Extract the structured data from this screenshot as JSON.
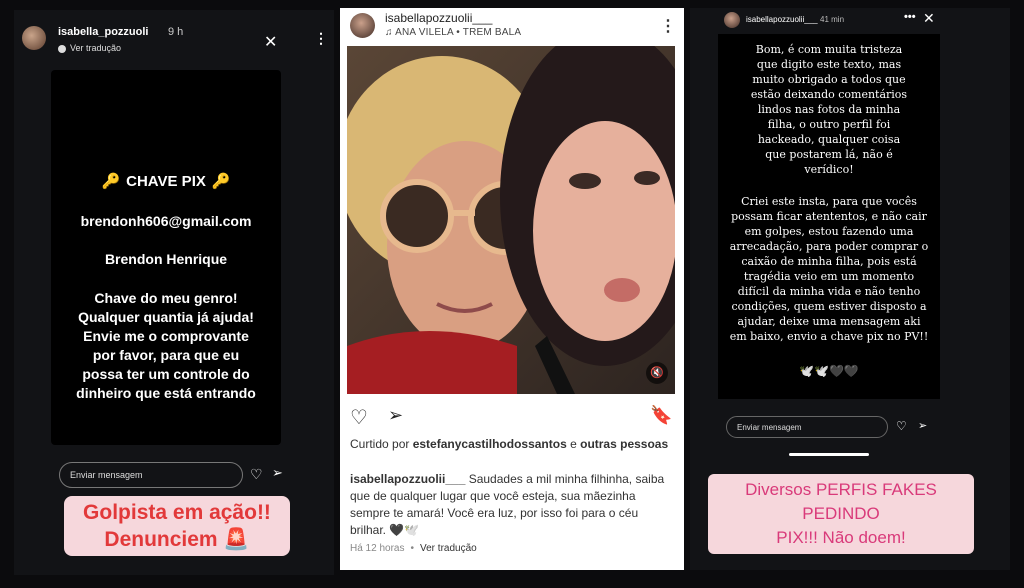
{
  "left_story": {
    "username": "isabella_pozzuoli",
    "time": "9 h",
    "translate_label": "Ver tradução",
    "pix_title": "CHAVE PIX",
    "email": "brendonh606@gmail.com",
    "name": "Brendon Henrique",
    "message_lines": [
      "Chave do meu genro!",
      "Qualquer quantia já ajuda!",
      "Envie me o comprovante",
      "por favor, para que eu",
      "possa ter um controle do",
      "dinheiro que está entrando"
    ],
    "reply_placeholder": "Enviar mensagem",
    "sticker_line1": "Golpista em ação!!",
    "sticker_line2": "Denunciem 🚨"
  },
  "post": {
    "username": "isabellapozzuolii___",
    "music": "ANA VILELA • TREM BALA",
    "liked_prefix": "Curtido por ",
    "liked_user": "estefanycastilhodossantos",
    "liked_suffix": " e ",
    "liked_others": "outras pessoas",
    "caption_user": "isabellapozzuolii___",
    "caption_text": " Saudades a mil minha filhinha, saiba que de qualquer lugar que você esteja, sua mãezinha sempre te amará! Você era luz, por isso foi para o céu brilhar. 🖤🕊️",
    "time_ago": "Há 12 horas",
    "translate_label": "Ver tradução"
  },
  "right_story": {
    "username": "isabellapozzuolii___",
    "time": "41 min",
    "para1": [
      "Bom, é com muita tristeza",
      "que digito este texto, mas",
      "muito obrigado a todos que",
      "estão deixando comentários",
      "lindos nas fotos da minha",
      "filha, o outro perfil foi",
      "hackeado, qualquer coisa",
      "que postarem lá, não é",
      "verídico!"
    ],
    "para2": [
      "Criei este insta, para que vocês",
      "possam ficar atententos, e não cair",
      "em golpes, estou fazendo uma",
      "arrecadação, para poder comprar o",
      "caixão de minha filha, pois está",
      "tragédia veio em um momento",
      "difícil da minha vida e não tenho",
      "condições, quem estiver disposto a",
      "ajudar, deixe uma mensagem aki",
      "em baixo, envio a chave pix no PV!!"
    ],
    "doves": "🕊️🕊️🖤🖤",
    "reply_placeholder": "Enviar mensagem",
    "sticker_line1": "Diversos PERFIS FAKES PEDINDO",
    "sticker_line2": "PIX!!! Não doem!"
  },
  "colors": {
    "sticker_bg": "#f6d7dc",
    "sticker_red": "#e2393a",
    "sticker_pink": "#d93a7a",
    "key_gold": "#f2c230"
  }
}
